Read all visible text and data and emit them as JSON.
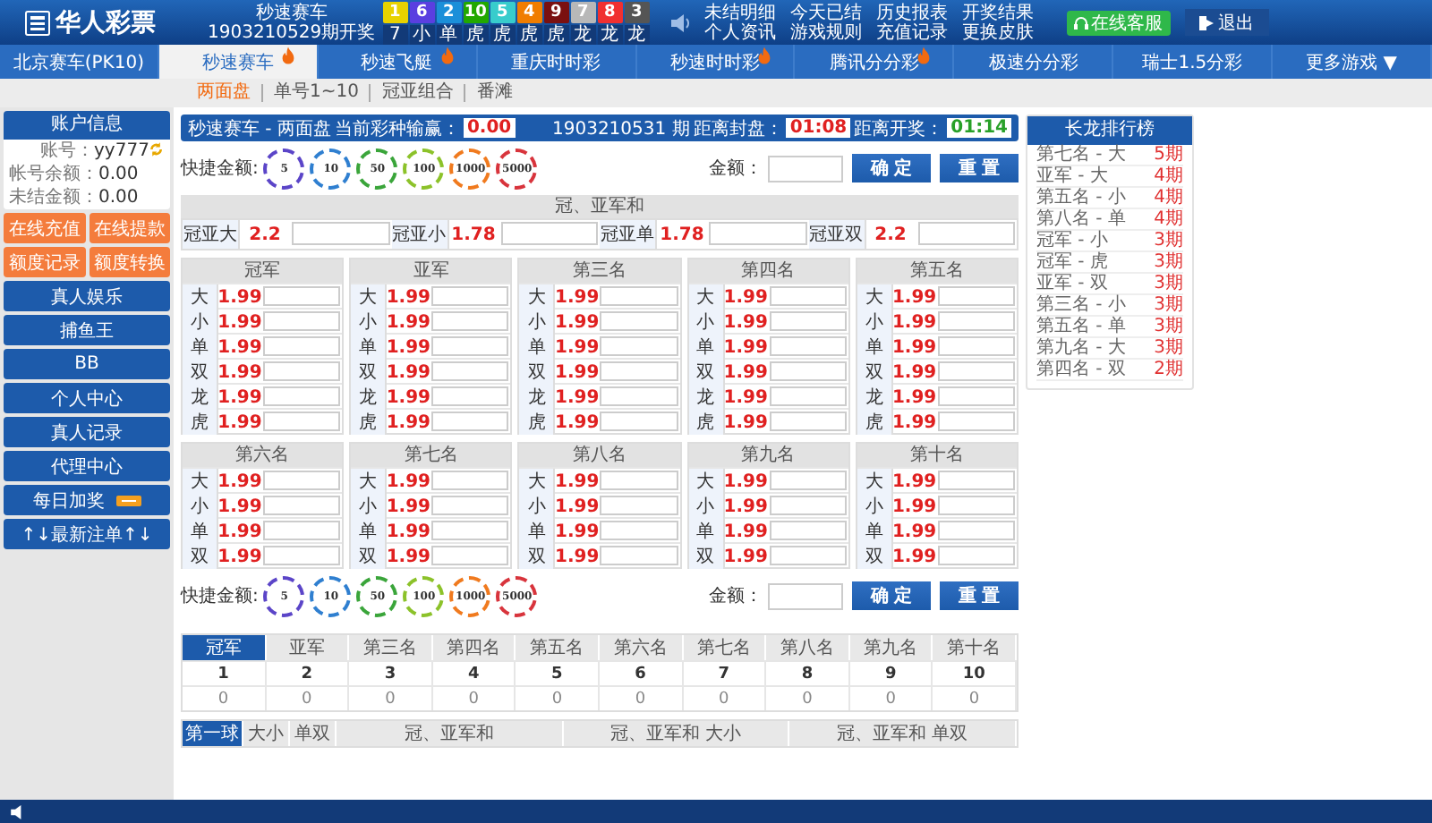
{
  "header": {
    "logo": "华人彩票",
    "lottery": {
      "name": "秒速赛车",
      "draw": "1903210529期开奖"
    },
    "balls": [
      {
        "number": "1",
        "label": "7",
        "color": "#e8d200"
      },
      {
        "number": "6",
        "label": "小",
        "color": "#5a3fe0"
      },
      {
        "number": "2",
        "label": "单",
        "color": "#1b8fd9"
      },
      {
        "number": "10",
        "label": "虎",
        "color": "#22a800"
      },
      {
        "number": "5",
        "label": "虎",
        "color": "#38cccc"
      },
      {
        "number": "4",
        "label": "虎",
        "color": "#f07d00"
      },
      {
        "number": "9",
        "label": "虎",
        "color": "#7a1010"
      },
      {
        "number": "7",
        "label": "龙",
        "color": "#b8b8b8"
      },
      {
        "number": "8",
        "label": "龙",
        "color": "#f03030"
      },
      {
        "number": "3",
        "label": "龙",
        "color": "#555555"
      }
    ],
    "links": [
      "未结明细",
      "今天已结",
      "历史报表",
      "开奖结果",
      "个人资讯",
      "游戏规则",
      "充值记录",
      "更换皮肤"
    ],
    "service_button": "在线客服",
    "logout_button": "退出"
  },
  "nav_tabs": [
    {
      "label": "北京赛车(PK10)",
      "selected": false,
      "hot": false
    },
    {
      "label": "秒速赛车",
      "selected": true,
      "hot": true
    },
    {
      "label": "秒速飞艇",
      "selected": false,
      "hot": true
    },
    {
      "label": "重庆时时彩",
      "selected": false,
      "hot": false
    },
    {
      "label": "秒速时时彩",
      "selected": false,
      "hot": true
    },
    {
      "label": "腾讯分分彩",
      "selected": false,
      "hot": true
    },
    {
      "label": "极速分分彩",
      "selected": false,
      "hot": false
    },
    {
      "label": "瑞士1.5分彩",
      "selected": false,
      "hot": false
    },
    {
      "label": "更多游戏 ▼",
      "selected": false,
      "hot": false
    }
  ],
  "sub_tabs": [
    {
      "label": "两面盘",
      "selected": true
    },
    {
      "label": "单号1~10",
      "selected": false
    },
    {
      "label": "冠亚组合",
      "selected": false
    },
    {
      "label": "番滩",
      "selected": false
    }
  ],
  "account": {
    "title": "账户信息",
    "fields": [
      {
        "label": "账号：",
        "value": "yy777"
      },
      {
        "label": "帐号余额：",
        "value": "0.00"
      },
      {
        "label": "未结金额：",
        "value": "0.00"
      }
    ]
  },
  "action_buttons": [
    "在线充值",
    "在线提款",
    "额度记录",
    "额度转换"
  ],
  "menu": [
    {
      "label": "真人娱乐",
      "badge": false
    },
    {
      "label": "捕鱼王",
      "badge": false
    },
    {
      "label": "BB",
      "badge": false
    },
    {
      "label": "个人中心",
      "badge": false
    },
    {
      "label": "真人记录",
      "badge": false
    },
    {
      "label": "代理中心",
      "badge": false
    },
    {
      "label": "每日加奖",
      "badge": true
    },
    {
      "label": "↑↓最新注单↑↓",
      "badge": false
    }
  ],
  "bet_header": {
    "game": "秒速赛车 - 两面盘",
    "profit_label": "当前彩种输赢：",
    "profit": "0.00",
    "period": "1903210531 期",
    "close_label": "距离封盘：",
    "close_time": "01:08",
    "open_label": "距离开奖：",
    "open_time": "01:14"
  },
  "quick_bet": [
    {
      "label": "快捷金额:",
      "chips": [
        {
          "value": "5",
          "color": "#5b45c8"
        },
        {
          "value": "10",
          "color": "#2f7fd0"
        },
        {
          "value": "50",
          "color": "#3aa53a"
        },
        {
          "value": "100",
          "color": "#8cc22a"
        },
        {
          "value": "1000",
          "color": "#f07a1e"
        },
        {
          "value": "5000",
          "color": "#d8343c"
        }
      ],
      "amount_label": "金额：",
      "buttons": [
        "确 定",
        "重 置"
      ]
    },
    {
      "label": "快捷金额:",
      "chips": [
        {
          "value": "5",
          "color": "#5b45c8"
        },
        {
          "value": "10",
          "color": "#2f7fd0"
        },
        {
          "value": "50",
          "color": "#3aa53a"
        },
        {
          "value": "100",
          "color": "#8cc22a"
        },
        {
          "value": "1000",
          "color": "#f07a1e"
        },
        {
          "value": "5000",
          "color": "#d8343c"
        }
      ],
      "amount_label": "金额：",
      "buttons": [
        "确 定",
        "重 置"
      ]
    }
  ],
  "sum_section": {
    "title": "冠、亚军和",
    "items": [
      {
        "label": "冠亚大",
        "odds": "2.2"
      },
      {
        "label": "冠亚小",
        "odds": "1.78"
      },
      {
        "label": "冠亚单",
        "odds": "1.78"
      },
      {
        "label": "冠亚双",
        "odds": "2.2"
      }
    ]
  },
  "positions": [
    {
      "title": "冠军",
      "rows": [
        {
          "label": "大",
          "odds": "1.99"
        },
        {
          "label": "小",
          "odds": "1.99"
        },
        {
          "label": "单",
          "odds": "1.99"
        },
        {
          "label": "双",
          "odds": "1.99"
        },
        {
          "label": "龙",
          "odds": "1.99"
        },
        {
          "label": "虎",
          "odds": "1.99"
        }
      ]
    },
    {
      "title": "亚军",
      "rows": [
        {
          "label": "大",
          "odds": "1.99"
        },
        {
          "label": "小",
          "odds": "1.99"
        },
        {
          "label": "单",
          "odds": "1.99"
        },
        {
          "label": "双",
          "odds": "1.99"
        },
        {
          "label": "龙",
          "odds": "1.99"
        },
        {
          "label": "虎",
          "odds": "1.99"
        }
      ]
    },
    {
      "title": "第三名",
      "rows": [
        {
          "label": "大",
          "odds": "1.99"
        },
        {
          "label": "小",
          "odds": "1.99"
        },
        {
          "label": "单",
          "odds": "1.99"
        },
        {
          "label": "双",
          "odds": "1.99"
        },
        {
          "label": "龙",
          "odds": "1.99"
        },
        {
          "label": "虎",
          "odds": "1.99"
        }
      ]
    },
    {
      "title": "第四名",
      "rows": [
        {
          "label": "大",
          "odds": "1.99"
        },
        {
          "label": "小",
          "odds": "1.99"
        },
        {
          "label": "单",
          "odds": "1.99"
        },
        {
          "label": "双",
          "odds": "1.99"
        },
        {
          "label": "龙",
          "odds": "1.99"
        },
        {
          "label": "虎",
          "odds": "1.99"
        }
      ]
    },
    {
      "title": "第五名",
      "rows": [
        {
          "label": "大",
          "odds": "1.99"
        },
        {
          "label": "小",
          "odds": "1.99"
        },
        {
          "label": "单",
          "odds": "1.99"
        },
        {
          "label": "双",
          "odds": "1.99"
        },
        {
          "label": "龙",
          "odds": "1.99"
        },
        {
          "label": "虎",
          "odds": "1.99"
        }
      ]
    },
    {
      "title": "第六名",
      "rows": [
        {
          "label": "大",
          "odds": "1.99"
        },
        {
          "label": "小",
          "odds": "1.99"
        },
        {
          "label": "单",
          "odds": "1.99"
        },
        {
          "label": "双",
          "odds": "1.99"
        }
      ]
    },
    {
      "title": "第七名",
      "rows": [
        {
          "label": "大",
          "odds": "1.99"
        },
        {
          "label": "小",
          "odds": "1.99"
        },
        {
          "label": "单",
          "odds": "1.99"
        },
        {
          "label": "双",
          "odds": "1.99"
        }
      ]
    },
    {
      "title": "第八名",
      "rows": [
        {
          "label": "大",
          "odds": "1.99"
        },
        {
          "label": "小",
          "odds": "1.99"
        },
        {
          "label": "单",
          "odds": "1.99"
        },
        {
          "label": "双",
          "odds": "1.99"
        }
      ]
    },
    {
      "title": "第九名",
      "rows": [
        {
          "label": "大",
          "odds": "1.99"
        },
        {
          "label": "小",
          "odds": "1.99"
        },
        {
          "label": "单",
          "odds": "1.99"
        },
        {
          "label": "双",
          "odds": "1.99"
        }
      ]
    },
    {
      "title": "第十名",
      "rows": [
        {
          "label": "大",
          "odds": "1.99"
        },
        {
          "label": "小",
          "odds": "1.99"
        },
        {
          "label": "单",
          "odds": "1.99"
        },
        {
          "label": "双",
          "odds": "1.99"
        }
      ]
    }
  ],
  "stats": {
    "tabs": [
      {
        "label": "冠军",
        "selected": true
      },
      {
        "label": "亚军",
        "selected": false
      },
      {
        "label": "第三名",
        "selected": false
      },
      {
        "label": "第四名",
        "selected": false
      },
      {
        "label": "第五名",
        "selected": false
      },
      {
        "label": "第六名",
        "selected": false
      },
      {
        "label": "第七名",
        "selected": false
      },
      {
        "label": "第八名",
        "selected": false
      },
      {
        "label": "第九名",
        "selected": false
      },
      {
        "label": "第十名",
        "selected": false
      }
    ],
    "numbers": [
      "1",
      "2",
      "3",
      "4",
      "5",
      "6",
      "7",
      "8",
      "9",
      "10"
    ],
    "counts": [
      "0",
      "0",
      "0",
      "0",
      "0",
      "0",
      "0",
      "0",
      "0",
      "0"
    ]
  },
  "bottom_tabs": [
    {
      "label": "第一球",
      "selected": true
    },
    {
      "label": "大小",
      "selected": false
    },
    {
      "label": "单双",
      "selected": false
    },
    {
      "label": "冠、亚军和",
      "selected": false
    },
    {
      "label": "冠、亚军和 大小",
      "selected": false
    },
    {
      "label": "冠、亚军和 单双",
      "selected": false
    }
  ],
  "long_dragon": {
    "title": "长龙排行榜",
    "items": [
      {
        "name": "第七名 - 大",
        "count": "5期"
      },
      {
        "name": "亚军 - 大",
        "count": "4期"
      },
      {
        "name": "第五名 - 小",
        "count": "4期"
      },
      {
        "name": "第八名 - 单",
        "count": "4期"
      },
      {
        "name": "冠军 - 小",
        "count": "3期"
      },
      {
        "name": "冠军 - 虎",
        "count": "3期"
      },
      {
        "name": "亚军 - 双",
        "count": "3期"
      },
      {
        "name": "第三名 - 小",
        "count": "3期"
      },
      {
        "name": "第五名 - 单",
        "count": "3期"
      },
      {
        "name": "第九名 - 大",
        "count": "3期"
      },
      {
        "name": "第四名 - 双",
        "count": "2期"
      }
    ]
  }
}
